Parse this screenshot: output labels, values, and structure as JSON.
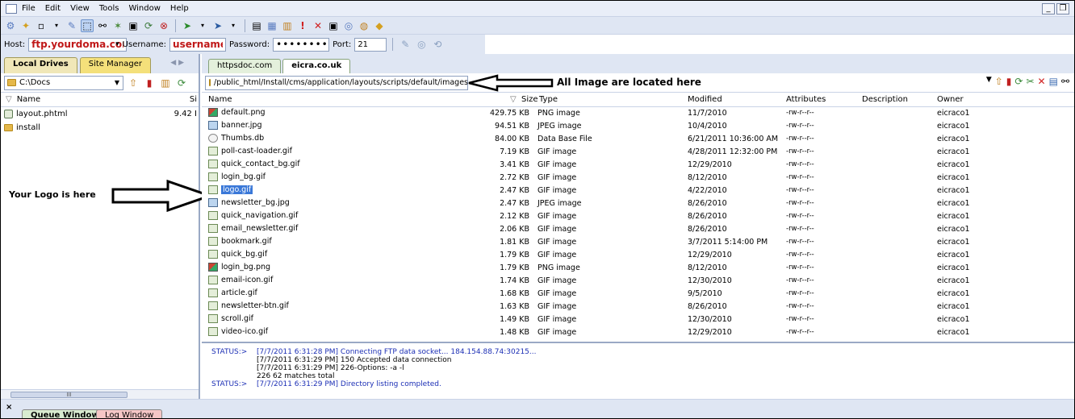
{
  "menu": [
    "File",
    "Edit",
    "View",
    "Tools",
    "Window",
    "Help"
  ],
  "connection": {
    "host_label": "Host:",
    "host_value": "ftp.yourdoma.com",
    "username_label": "Username:",
    "username_value": "username",
    "password_label": "Password:",
    "password_value": "••••••••",
    "port_label": "Port:",
    "port_value": "21"
  },
  "left_pane": {
    "tabs": [
      "Local Drives",
      "Site Manager"
    ],
    "path": "C:\\Docs",
    "col_name": "Name",
    "col_size": "Si",
    "files": [
      {
        "name": "layout.phtml",
        "size": "9.42 I"
      },
      {
        "name": "install",
        "size": ""
      }
    ],
    "annotation": "Your Logo is here"
  },
  "right_pane": {
    "tabs": [
      "httpsdoc.com",
      "eicra.co.uk"
    ],
    "path": "/public_html/Install/cms/application/layouts/scripts/default/images",
    "annotation": "All Image are located here",
    "columns": {
      "name": "Name",
      "size": "Size",
      "type": "Type",
      "modified": "Modified",
      "attributes": "Attributes",
      "description": "Description",
      "owner": "Owner"
    },
    "files": [
      {
        "name": "default.png",
        "size": "429.75 KB",
        "type": "PNG image",
        "modified": "11/7/2010",
        "attr": "-rw-r--r--",
        "owner": "eicraco1",
        "icon": "png"
      },
      {
        "name": "banner.jpg",
        "size": "94.51 KB",
        "type": "JPEG image",
        "modified": "10/4/2010",
        "attr": "-rw-r--r--",
        "owner": "eicraco1",
        "icon": "jpg"
      },
      {
        "name": "Thumbs.db",
        "size": "84.00 KB",
        "type": "Data Base File",
        "modified": "6/21/2011 10:36:00 AM",
        "attr": "-rw-r--r--",
        "owner": "eicraco1",
        "icon": "db"
      },
      {
        "name": "poll-cast-loader.gif",
        "size": "7.19 KB",
        "type": "GIF image",
        "modified": "4/28/2011 12:32:00 PM",
        "attr": "-rw-r--r--",
        "owner": "eicraco1",
        "icon": "gif"
      },
      {
        "name": "quick_contact_bg.gif",
        "size": "3.41 KB",
        "type": "GIF image",
        "modified": "12/29/2010",
        "attr": "-rw-r--r--",
        "owner": "eicraco1",
        "icon": "gif"
      },
      {
        "name": "login_bg.gif",
        "size": "2.72 KB",
        "type": "GIF image",
        "modified": "8/12/2010",
        "attr": "-rw-r--r--",
        "owner": "eicraco1",
        "icon": "gif"
      },
      {
        "name": "logo.gif",
        "size": "2.47 KB",
        "type": "GIF image",
        "modified": "4/22/2010",
        "attr": "-rw-r--r--",
        "owner": "eicraco1",
        "icon": "gif",
        "selected": true
      },
      {
        "name": "newsletter_bg.jpg",
        "size": "2.47 KB",
        "type": "JPEG image",
        "modified": "8/26/2010",
        "attr": "-rw-r--r--",
        "owner": "eicraco1",
        "icon": "jpg"
      },
      {
        "name": "quick_navigation.gif",
        "size": "2.12 KB",
        "type": "GIF image",
        "modified": "8/26/2010",
        "attr": "-rw-r--r--",
        "owner": "eicraco1",
        "icon": "gif"
      },
      {
        "name": "email_newsletter.gif",
        "size": "2.06 KB",
        "type": "GIF image",
        "modified": "8/26/2010",
        "attr": "-rw-r--r--",
        "owner": "eicraco1",
        "icon": "gif"
      },
      {
        "name": "bookmark.gif",
        "size": "1.81 KB",
        "type": "GIF image",
        "modified": "3/7/2011 5:14:00 PM",
        "attr": "-rw-r--r--",
        "owner": "eicraco1",
        "icon": "gif"
      },
      {
        "name": "quick_bg.gif",
        "size": "1.79 KB",
        "type": "GIF image",
        "modified": "12/29/2010",
        "attr": "-rw-r--r--",
        "owner": "eicraco1",
        "icon": "gif"
      },
      {
        "name": "login_bg.png",
        "size": "1.79 KB",
        "type": "PNG image",
        "modified": "8/12/2010",
        "attr": "-rw-r--r--",
        "owner": "eicraco1",
        "icon": "png"
      },
      {
        "name": "email-icon.gif",
        "size": "1.74 KB",
        "type": "GIF image",
        "modified": "12/30/2010",
        "attr": "-rw-r--r--",
        "owner": "eicraco1",
        "icon": "gif"
      },
      {
        "name": "article.gif",
        "size": "1.68 KB",
        "type": "GIF image",
        "modified": "9/5/2010",
        "attr": "-rw-r--r--",
        "owner": "eicraco1",
        "icon": "gif"
      },
      {
        "name": "newsletter-btn.gif",
        "size": "1.63 KB",
        "type": "GIF image",
        "modified": "8/26/2010",
        "attr": "-rw-r--r--",
        "owner": "eicraco1",
        "icon": "gif"
      },
      {
        "name": "scroll.gif",
        "size": "1.49 KB",
        "type": "GIF image",
        "modified": "12/30/2010",
        "attr": "-rw-r--r--",
        "owner": "eicraco1",
        "icon": "gif"
      },
      {
        "name": "video-ico.gif",
        "size": "1.48 KB",
        "type": "GIF image",
        "modified": "12/29/2010",
        "attr": "-rw-r--r--",
        "owner": "eicraco1",
        "icon": "gif"
      }
    ]
  },
  "status_log": [
    {
      "label": "STATUS:>",
      "text": "[7/7/2011 6:31:28 PM] Connecting FTP data socket... 184.154.88.74:30215..."
    },
    {
      "label": "",
      "text": "[7/7/2011 6:31:29 PM] 150 Accepted data connection"
    },
    {
      "label": "",
      "text": "[7/7/2011 6:31:29 PM] 226-Options: -a -l"
    },
    {
      "label": "",
      "text": "226 62 matches total"
    },
    {
      "label": "STATUS:>",
      "text": "[7/7/2011 6:31:29 PM] Directory listing completed."
    }
  ],
  "bottom_tabs": [
    "Queue Window",
    "Log Window"
  ]
}
